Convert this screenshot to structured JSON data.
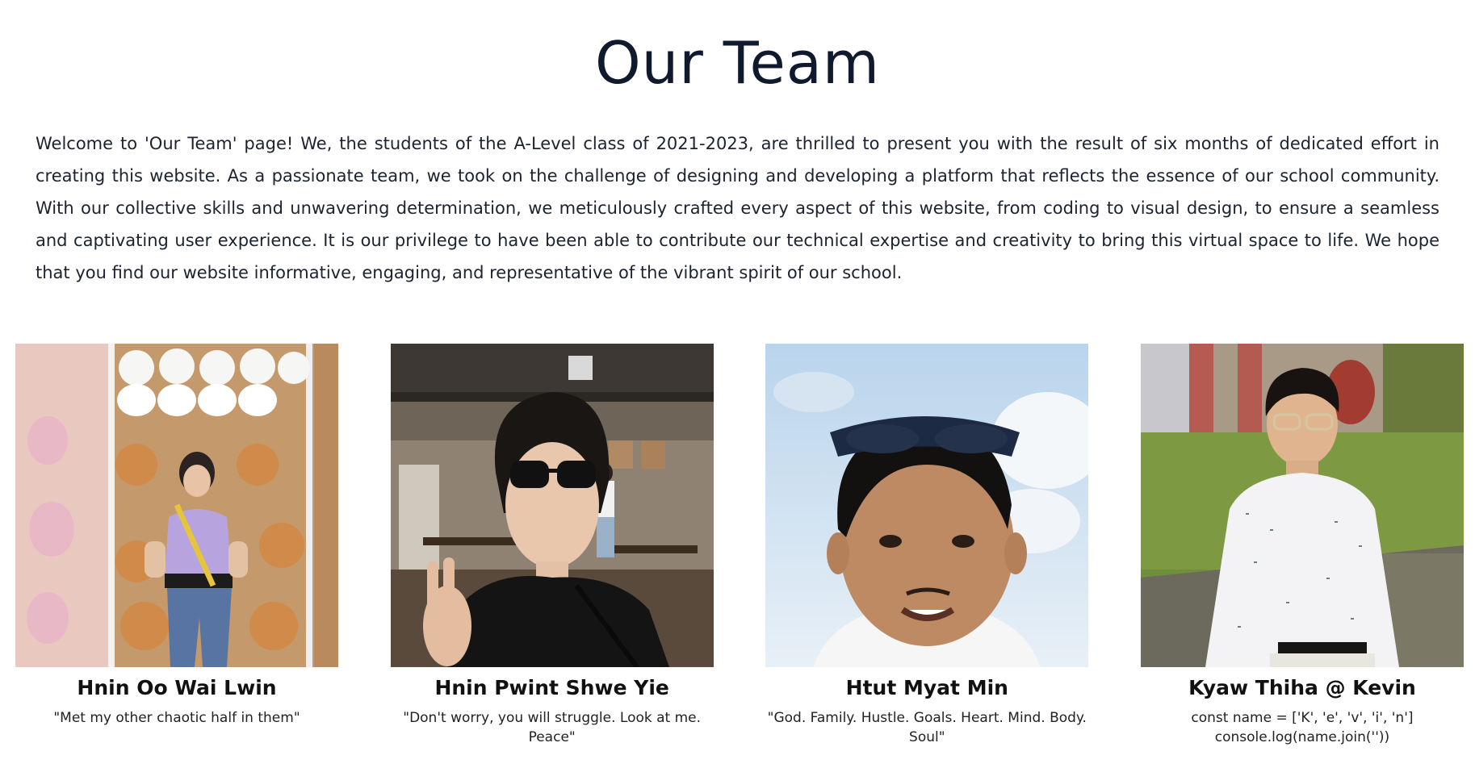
{
  "page": {
    "title": "Our Team",
    "intro": "Welcome to 'Our Team' page! We, the students of the A-Level class of 2021-2023, are thrilled to present you with the result of six months of dedicated effort in creating this website. As a passionate team, we took on the challenge of designing and developing a platform that reflects the essence of our school community. With our collective skills and unwavering determination, we meticulously crafted every aspect of this website, from coding to visual design, to ensure a seamless and captivating user experience. It is our privilege to have been able to contribute our technical expertise and creativity to bring this virtual space to life. We hope that you find our website informative, engaging, and representative of the vibrant spirit of our school."
  },
  "members": [
    {
      "name": "Hnin Oo Wai Lwin",
      "quote": "\"Met my other chaotic half in them\"",
      "photo_icon": "photo-plush-toy-shop"
    },
    {
      "name": "Hnin Pwint Shwe Yie",
      "quote": "\"Don't worry, you will struggle. Look at me. Peace\"",
      "photo_icon": "photo-restaurant-sunglasses"
    },
    {
      "name": "Htut Myat Min",
      "quote": "\"God. Family. Hustle. Goals. Heart. Mind. Body. Soul\"",
      "photo_icon": "photo-sky-selfie"
    },
    {
      "name": "Kyaw Thiha @ Kevin",
      "quote": "const name = ['K', 'e', 'v', 'i', 'n']\nconsole.log(name.join(''))",
      "photo_icon": "photo-garden-white-shirt"
    }
  ],
  "colors": {
    "title": "#101a2f",
    "text": "#1b2330",
    "background": "#ffffff"
  }
}
